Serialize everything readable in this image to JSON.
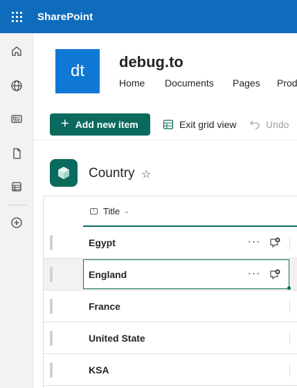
{
  "suite": {
    "app_name": "SharePoint"
  },
  "rail": {
    "items": [
      "home-icon",
      "globe-icon",
      "news-icon",
      "document-icon",
      "list-icon",
      "add-circle-icon"
    ]
  },
  "site": {
    "logo_text": "dt",
    "title": "debug.to",
    "nav": [
      "Home",
      "Documents",
      "Pages",
      "Prod"
    ]
  },
  "commands": {
    "add_new_item": "Add new item",
    "exit_grid_view": "Exit grid view",
    "undo": "Undo"
  },
  "list": {
    "title": "Country",
    "column_title": "Title",
    "rows": [
      "Egypt",
      "England",
      "France",
      "United State",
      "KSA"
    ],
    "row_more_label": "···"
  },
  "colors": {
    "suite_bar": "#0f6cbd",
    "accent": "#0b6a5e",
    "site_logo": "#0f78d4"
  }
}
